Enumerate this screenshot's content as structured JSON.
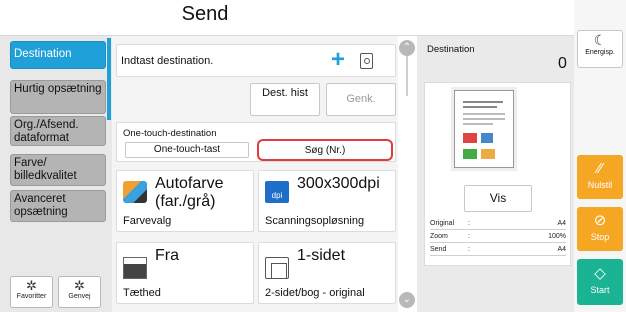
{
  "header": {
    "title": "Send"
  },
  "sidebar": {
    "items": [
      {
        "label": "Destination"
      },
      {
        "label": "Hurtig opsætning"
      },
      {
        "label": "Org./Afsend. dataformat"
      },
      {
        "label": "Farve/ billedkvalitet"
      },
      {
        "label": "Avanceret opsætning"
      }
    ],
    "bottom": [
      {
        "label": "Favoritter",
        "icon": "gear-icon"
      },
      {
        "label": "Genvej",
        "icon": "gear-icon"
      }
    ]
  },
  "destination": {
    "input_label": "Indtast destination.",
    "plus": "+",
    "dest_hist": "Dest. hist",
    "genk": "Genk.",
    "one_touch_label": "One-touch-destination",
    "one_touch_btn": "One-touch-tast",
    "search_btn": "Søg (Nr.)"
  },
  "features": [
    {
      "big": "Autofarve (far./grå)",
      "small": "Farvevalg",
      "icon": "color-mode-icon"
    },
    {
      "big": "300x300dpi",
      "small": "Scanningsopløsning",
      "icon": "dpi-icon"
    },
    {
      "big": "Fra",
      "small": "Tæthed",
      "icon": "density-icon"
    },
    {
      "big": "1-sidet",
      "small": "2-sidet/bog - original",
      "icon": "duplex-icon"
    }
  ],
  "icons": {
    "dpi_text": "dpi",
    "arrow_up": "⌃",
    "arrow_down": "⌄"
  },
  "preview": {
    "label": "Destination",
    "count": "0",
    "vis_btn": "Vis",
    "rows": [
      {
        "key": "Original",
        "colon": ":",
        "value": "A4"
      },
      {
        "key": "Zoom",
        "colon": ":",
        "value": "100%"
      },
      {
        "key": "Send",
        "colon": ":",
        "value": "A4"
      }
    ]
  },
  "right": {
    "energy": "Energisp.",
    "reset": "Nulstil",
    "stop": "Stop",
    "start": "Start"
  },
  "colors": {
    "accent": "#1fa0d8",
    "orange": "#f5a623",
    "start": "#1ab394",
    "highlight": "#e03c3c"
  }
}
